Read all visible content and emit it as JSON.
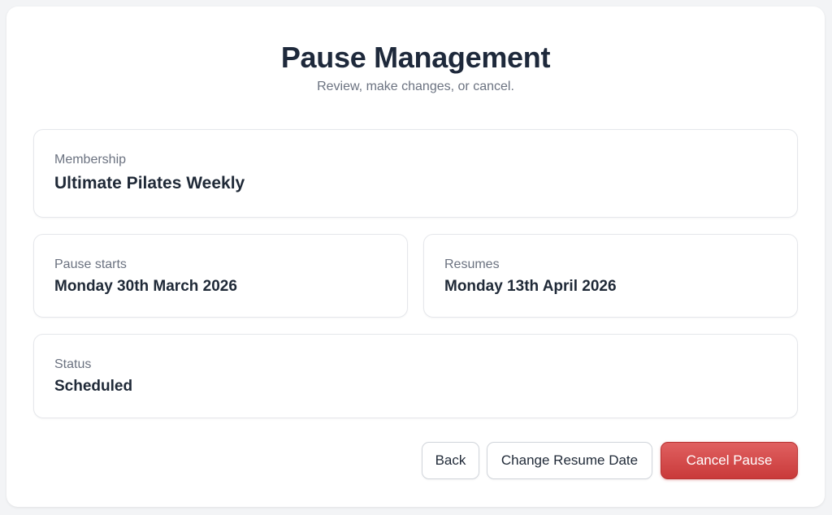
{
  "header": {
    "title": "Pause Management",
    "subtitle": "Review, make changes, or cancel."
  },
  "membership": {
    "label": "Membership",
    "value": "Ultimate Pilates Weekly"
  },
  "pause_start": {
    "label": "Pause starts",
    "value": "Monday 30th March 2026"
  },
  "resumes": {
    "label": "Resumes",
    "value": "Monday 13th April 2026"
  },
  "status": {
    "label": "Status",
    "value": "Scheduled"
  },
  "actions": {
    "back_label": "Back",
    "change_resume_label": "Change Resume Date",
    "cancel_pause_label": "Cancel Pause"
  },
  "colors": {
    "danger": "#d9534f",
    "title": "#1e293b",
    "muted": "#6b7280"
  }
}
